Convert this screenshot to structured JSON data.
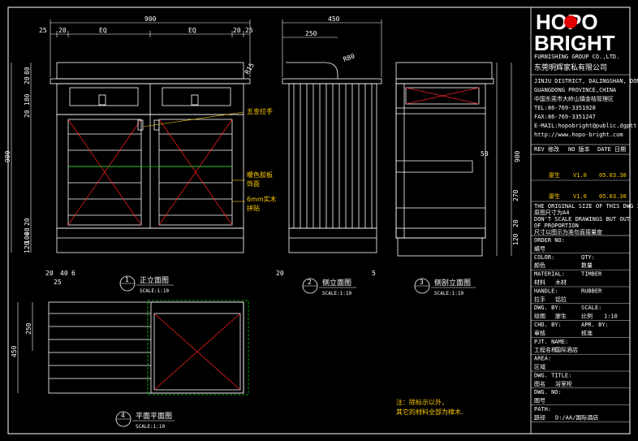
{
  "dims": {
    "front_width": "900",
    "front_eq_left": "EQ",
    "front_eq_right": "EQ",
    "front_top_25_left": "25",
    "front_top_20_left": "20",
    "front_top_20_right": "20",
    "front_top_25_right": "25",
    "side_width": "450",
    "side_250": "250",
    "side_r": "R80",
    "front_r": "R15",
    "left_20a": "20",
    "left_80": "80",
    "left_180": "180",
    "left_20b": "20",
    "left_20c": "20",
    "left_900": "900",
    "left_40": "40",
    "left_100": "100",
    "left_120": "120",
    "bottom_20": "20",
    "bottom_40": "40",
    "bottom_6": "6",
    "bottom_25": "25",
    "side_bottom_20": "20",
    "side_bottom_5": "5",
    "right_900": "900",
    "right_270": "270",
    "right_120": "120",
    "right_20": "20",
    "inner_50": "50",
    "plan_250": "250",
    "plan_450": "450"
  },
  "annotations": {
    "handle": "五金拉手",
    "veneer_line1": "暖色胶板",
    "veneer_line2": "饰面",
    "legs_line1": "6mm实木",
    "legs_line2": "拼贴",
    "bottom_note_line1": "注：除标示以外，",
    "bottom_note_line2": "其它的材料全部为樟木."
  },
  "views": [
    {
      "num": "1",
      "title": "正立面图",
      "scale": "SCALE:1:10"
    },
    {
      "num": "2",
      "title": "侧立面图",
      "scale": "SCALE:1:10"
    },
    {
      "num": "3",
      "title": "侧剖立面图",
      "scale": "SCALE:1:10"
    },
    {
      "num": "4",
      "title": "平面平面图",
      "scale": "SCALE:1:10"
    }
  ],
  "titleblock": {
    "logo_line1": "HOPO",
    "logo_line2": "BRIGHT",
    "logo_sub": "FURNISHING GROUP CO.,LTD.",
    "company_cn": "东莞明辉家私有限公司",
    "address_lines": [
      "JINJU DISTRICT, DALINGSHAN, DONGGUAN",
      "GUANGDONG PROVINCE,CHINA",
      "中国东莞市大岭山镇金桔管理区",
      "TEL:86-769-3351928",
      "FAX:86-769-3351247",
      "E-MAIL:hopobright@public.dgptt.gd.cn",
      "http://www.hopo-bright.com"
    ],
    "rev_header": [
      "REV 修改",
      "NO 版本",
      "DATE 日期"
    ],
    "rev_rows": [
      [
        "廖生",
        "V1.0",
        "05.03.30"
      ],
      [
        "廖生",
        "V1.0",
        "05.03.30"
      ]
    ],
    "orig_size_lines": [
      "THE ORIGINAL SIZE OF THIS DWG IS A4",
      "原图尺寸为A4",
      "DON'T SCALE DRAWINGS BUT OUT",
      "OF PROPORTION",
      "尺寸以图示为准勿直接量度"
    ],
    "fields": [
      {
        "label": "ORDER NO:",
        "value": ""
      },
      {
        "label": "编号",
        "value": ""
      },
      {
        "label": "COLOR:",
        "value": "",
        "label2": "QTY:"
      },
      {
        "label": "颜色",
        "value": "",
        "label2": "数量"
      },
      {
        "label": "MATERIAL:",
        "value": "TIMBER"
      },
      {
        "label": "材料",
        "value": "木材"
      },
      {
        "label": "HANDLE:",
        "value": "RUBBER"
      },
      {
        "label": "拉手",
        "value": "铝拉"
      },
      {
        "label": "DWG. BY:",
        "value": "",
        "label2": "SCALE:"
      },
      {
        "label": "绘图",
        "value": "廖生",
        "label2": "比例",
        "value2": "1:10"
      },
      {
        "label": "CHD. BY:",
        "value": "",
        "label2": "APR. BY:"
      },
      {
        "label": "审核",
        "value": "",
        "label2": "核准"
      },
      {
        "label": "PJT. NAME:",
        "value": ""
      },
      {
        "label": "工程名称",
        "value": "国际酒店"
      },
      {
        "label": "AREA:",
        "value": ""
      },
      {
        "label": "区域",
        "value": ""
      },
      {
        "label": "DWG. TITLE:",
        "value": ""
      },
      {
        "label": "图名",
        "value": "浴室柜"
      },
      {
        "label": "DWG. NO:",
        "value": ""
      },
      {
        "label": "图号",
        "value": ""
      },
      {
        "label": "PATH:",
        "value": ""
      },
      {
        "label": "路径",
        "value": "D:/AA/国际酒店"
      }
    ]
  },
  "colors": {
    "background": "#000000",
    "line": "#ffffff",
    "red": "#ff2020",
    "green": "#00cc00",
    "yellow": "#ffcc00",
    "logo_red": "#e00000"
  }
}
